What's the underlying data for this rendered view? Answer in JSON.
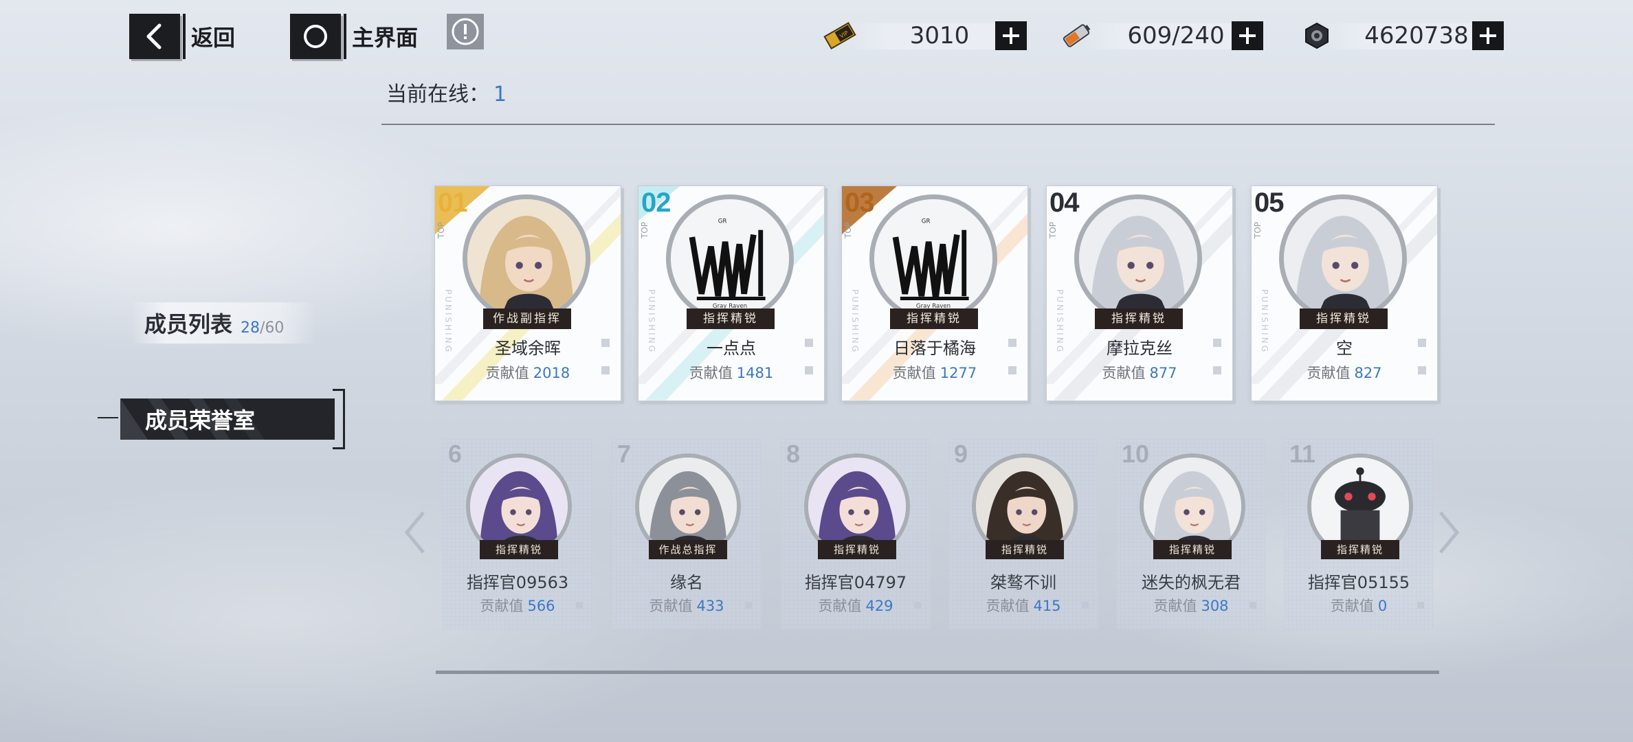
{
  "nav": {
    "back_label": "返回",
    "home_label": "主界面",
    "back_icon": "chevron-left-icon",
    "home_icon": "circle-icon",
    "info_icon": "exclamation-icon"
  },
  "resources": [
    {
      "icon": "ticket-icon",
      "value": "3010"
    },
    {
      "icon": "battery-icon",
      "value": "609/240"
    },
    {
      "icon": "hex-nut-icon",
      "value": "4620738"
    }
  ],
  "online": {
    "label": "当前在线：",
    "count": "1"
  },
  "tabs": {
    "members": {
      "label": "成员列表",
      "count_current": "28",
      "count_total": "/60"
    },
    "honor": {
      "label": "成员荣誉室"
    }
  },
  "contribution_label": "贡献值",
  "top_members": [
    {
      "rank": "01",
      "name": "圣域余晖",
      "title": "作战副指挥",
      "contribution": "2018",
      "rank_color": "#e8b23a",
      "stripe_color": "#f4e7a0"
    },
    {
      "rank": "02",
      "name": "一点点",
      "title": "指挥精锐",
      "contribution": "1481",
      "rank_color": "#23a6c7",
      "stripe_color": "#bfeaf0"
    },
    {
      "rank": "03",
      "name": "日落于橘海",
      "title": "指挥精锐",
      "contribution": "1277",
      "rank_color": "#b0651f",
      "stripe_color": "#f6d7b8"
    },
    {
      "rank": "04",
      "name": "摩拉克丝",
      "title": "指挥精锐",
      "contribution": "877",
      "rank_color": "#2b2e34",
      "stripe_color": "#dfe3e8"
    },
    {
      "rank": "05",
      "name": "空",
      "title": "指挥精锐",
      "contribution": "827",
      "rank_color": "#2b2e34",
      "stripe_color": "#dfe3e8"
    }
  ],
  "top_tag": "TOP",
  "card_vertical_text": "PUNISHING",
  "other_members": [
    {
      "rank": "6",
      "name": "指挥官09563",
      "title": "指挥精锐",
      "contribution": "566"
    },
    {
      "rank": "7",
      "name": "缘名",
      "title": "作战总指挥",
      "contribution": "433"
    },
    {
      "rank": "8",
      "name": "指挥官04797",
      "title": "指挥精锐",
      "contribution": "429"
    },
    {
      "rank": "9",
      "name": "桀骜不训",
      "title": "指挥精锐",
      "contribution": "415"
    },
    {
      "rank": "10",
      "name": "迷失的枫无君",
      "title": "指挥精锐",
      "contribution": "308"
    },
    {
      "rank": "11",
      "name": "指挥官05155",
      "title": "指挥精锐",
      "contribution": "0"
    }
  ]
}
